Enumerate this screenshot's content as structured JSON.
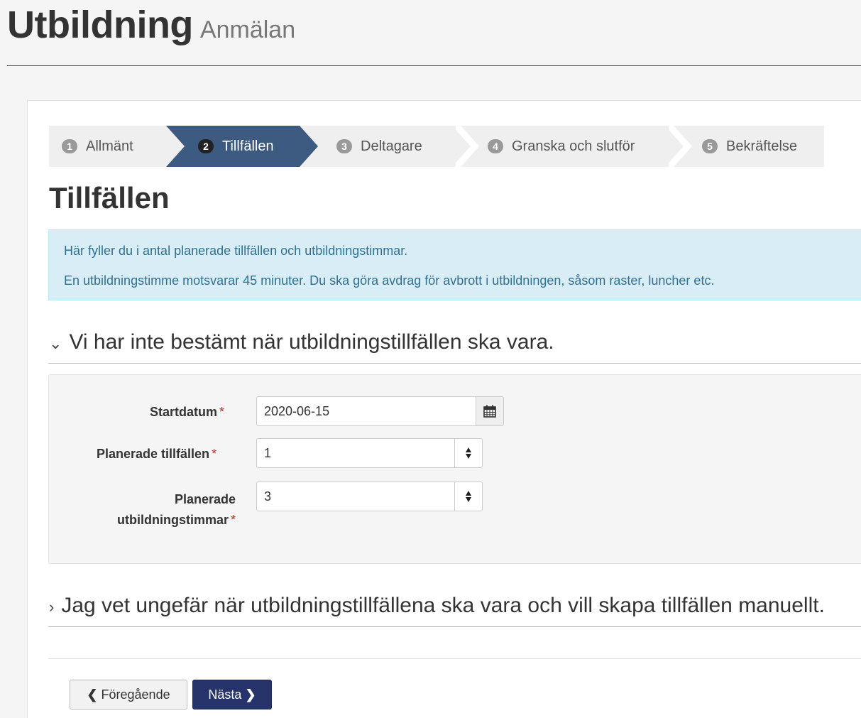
{
  "header": {
    "title": "Utbildning",
    "subtitle": "Anmälan"
  },
  "steps": [
    {
      "number": "1",
      "label": "Allmänt"
    },
    {
      "number": "2",
      "label": "Tillfällen",
      "active": true
    },
    {
      "number": "3",
      "label": "Deltagare"
    },
    {
      "number": "4",
      "label": "Granska och slutför"
    },
    {
      "number": "5",
      "label": "Bekräftelse"
    }
  ],
  "section_title": "Tillfällen",
  "info": {
    "line1": "Här fyller du i antal planerade tillfällen och utbildningstimmar.",
    "line2": "En utbildningstimme motsvarar 45 minuter. Du ska göra avdrag för avbrott i utbildningen, såsom raster, luncher etc."
  },
  "accordion1": {
    "chevron": "⌄",
    "text": "Vi har inte bestämt när utbildningstillfällen ska vara."
  },
  "form": {
    "required_mark": "*",
    "startdatum": {
      "label": "Startdatum",
      "value": "2020-06-15",
      "icon": "calendar-icon"
    },
    "tillfallen": {
      "label": "Planerade tillfällen",
      "value": "1"
    },
    "timmar": {
      "label_line1": "Planerade",
      "label_line2": "utbildningstimmar",
      "value": "3"
    }
  },
  "accordion2": {
    "chevron": "›",
    "text": "Jag vet ungefär när utbildningstillfällena ska vara och vill skapa tillfällen manuellt."
  },
  "buttons": {
    "prev": {
      "icon": "❮",
      "label": "Föregående"
    },
    "next": {
      "icon": "❯",
      "label": "Nästa"
    }
  },
  "colors": {
    "active_step": "#3d5a80",
    "primary_button": "#27336b",
    "info_bg": "#d9edf7",
    "info_text": "#31708f"
  }
}
